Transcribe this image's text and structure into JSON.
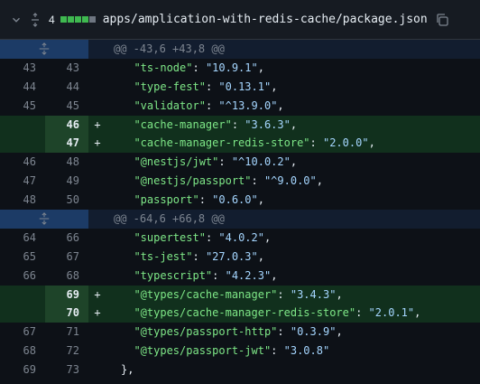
{
  "file": {
    "changes_count": "4",
    "path": "apps/amplication-with-redis-cache/package.json",
    "diffstat_colors": [
      "#3fb950",
      "#3fb950",
      "#3fb950",
      "#3fb950",
      "#6e7681"
    ]
  },
  "hunks": [
    {
      "header": "@@ -43,6 +43,8 @@",
      "lines": [
        {
          "old": "43",
          "new": "43",
          "sign": "",
          "key": "\"ts-node\"",
          "val": "\"10.9.1\"",
          "tail": ",",
          "type": "ctx"
        },
        {
          "old": "44",
          "new": "44",
          "sign": "",
          "key": "\"type-fest\"",
          "val": "\"0.13.1\"",
          "tail": ",",
          "type": "ctx"
        },
        {
          "old": "45",
          "new": "45",
          "sign": "",
          "key": "\"validator\"",
          "val": "\"^13.9.0\"",
          "tail": ",",
          "type": "ctx"
        },
        {
          "old": "",
          "new": "46",
          "sign": "+",
          "key": "\"cache-manager\"",
          "val": "\"3.6.3\"",
          "tail": ",",
          "type": "add"
        },
        {
          "old": "",
          "new": "47",
          "sign": "+",
          "key": "\"cache-manager-redis-store\"",
          "val": "\"2.0.0\"",
          "tail": ",",
          "type": "add"
        },
        {
          "old": "46",
          "new": "48",
          "sign": "",
          "key": "\"@nestjs/jwt\"",
          "val": "\"^10.0.2\"",
          "tail": ",",
          "type": "ctx"
        },
        {
          "old": "47",
          "new": "49",
          "sign": "",
          "key": "\"@nestjs/passport\"",
          "val": "\"^9.0.0\"",
          "tail": ",",
          "type": "ctx"
        },
        {
          "old": "48",
          "new": "50",
          "sign": "",
          "key": "\"passport\"",
          "val": "\"0.6.0\"",
          "tail": ",",
          "type": "ctx"
        }
      ]
    },
    {
      "header": "@@ -64,6 +66,8 @@",
      "lines": [
        {
          "old": "64",
          "new": "66",
          "sign": "",
          "key": "\"supertest\"",
          "val": "\"4.0.2\"",
          "tail": ",",
          "type": "ctx"
        },
        {
          "old": "65",
          "new": "67",
          "sign": "",
          "key": "\"ts-jest\"",
          "val": "\"27.0.3\"",
          "tail": ",",
          "type": "ctx"
        },
        {
          "old": "66",
          "new": "68",
          "sign": "",
          "key": "\"typescript\"",
          "val": "\"4.2.3\"",
          "tail": ",",
          "type": "ctx"
        },
        {
          "old": "",
          "new": "69",
          "sign": "+",
          "key": "\"@types/cache-manager\"",
          "val": "\"3.4.3\"",
          "tail": ",",
          "type": "add"
        },
        {
          "old": "",
          "new": "70",
          "sign": "+",
          "key": "\"@types/cache-manager-redis-store\"",
          "val": "\"2.0.1\"",
          "tail": ",",
          "type": "add"
        },
        {
          "old": "67",
          "new": "71",
          "sign": "",
          "key": "\"@types/passport-http\"",
          "val": "\"0.3.9\"",
          "tail": ",",
          "type": "ctx"
        },
        {
          "old": "68",
          "new": "72",
          "sign": "",
          "key": "\"@types/passport-jwt\"",
          "val": "\"3.0.8\"",
          "tail": "",
          "type": "ctx"
        },
        {
          "old": "69",
          "new": "73",
          "sign": "",
          "key": "",
          "val": "",
          "tail": "},",
          "type": "close"
        }
      ]
    }
  ]
}
